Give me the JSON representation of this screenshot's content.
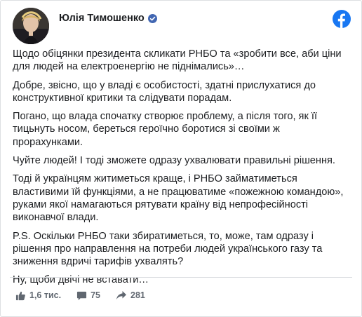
{
  "post": {
    "author": "Юлія Тимошенко",
    "verified": true,
    "paragraphs": [
      "Щодо обіцянки президента скликати РНБО та «зробити все, аби ціни для людей на електроенергію не піднімались»…",
      "Добре, звісно, що у владі є особистості, здатні прислухатися до конструктивної критики та слідувати порадам.",
      "Погано, що влада спочатку створює проблему, а після того, як її тицьнуть носом, береться героїчно боротися зі своїми ж прорахунками.",
      "Чуйте людей! І тоді зможете одразу ухвалювати правильні рішення.",
      "Тоді й українцям житиметься краще, і РНБО займатиметься властивими їй функціями, а не працюватиме «пожежною командою», руками якої намагаються рятувати країну від непрофесійності виконавчої влади.",
      "P.S. Оскільки РНБО таки збиратиметься, то, може, там одразу і рішення про направлення на потреби людей українського газу та зниження вдричі тарифів ухвалять?",
      "Ну, щоби двічі не вставати…"
    ]
  },
  "footer": {
    "likes": "1,6 тис.",
    "comments": "75",
    "shares": "281"
  },
  "icons": {
    "platform": "facebook-icon",
    "like": "thumbs-up-icon",
    "comment": "comment-icon",
    "share": "share-icon",
    "verified": "verified-badge-icon"
  },
  "colors": {
    "facebook_blue": "#1877f2",
    "verified_blue": "#4267b2",
    "text": "#1c1e21",
    "muted": "#606770"
  }
}
